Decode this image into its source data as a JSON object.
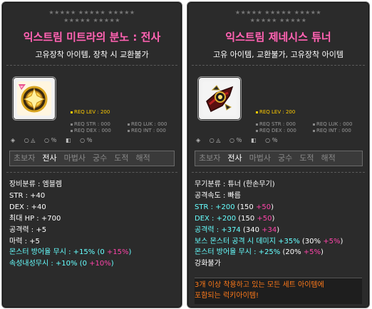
{
  "left": {
    "stars_row1": "★★★★★ ★★★★★ ★★★★★",
    "stars_row2": "★★★★★ ★★★★★",
    "title": "익스트림 미트라의 분노 : 전사",
    "desc": "고유장착 아이템, 장착 시 교환불가",
    "req_lev": "REQ LEV : 200",
    "req_str": "REQ STR : 000",
    "req_dex": "REQ DEX : 000",
    "req_luk": "REQ LUK : 000",
    "req_int": "REQ INT : 000",
    "jobs": [
      "초보자",
      "전사",
      "마법사",
      "궁수",
      "도적",
      "해적"
    ],
    "active_job_index": 1,
    "lines": {
      "category": "장비분류 : 엠블렘",
      "str": "STR : +40",
      "dex": "DEX : +40",
      "hp": "최대 HP : +700",
      "att": "공격력 : +5",
      "matt": "마력 : +5",
      "ignore_def_label": "몬스터 방어율 무시 : +15% (0 ",
      "ignore_def_bonus": "+15%",
      "ignore_def_close": ")",
      "ele_label": "속성내성무시 : +10% (0 ",
      "ele_bonus": "+10%",
      "ele_close": ")"
    }
  },
  "right": {
    "stars_row1": "★★★★★ ★★★★★ ★★★★★",
    "stars_row2": "★★★★★ ★★★★★",
    "title": "익스트림 제네시스 튜너",
    "desc": "고유 아이템, 교환불가, 고유장착 아이템",
    "req_lev": "REQ LEV : 200",
    "req_str": "REQ STR : 000",
    "req_dex": "REQ DEX : 000",
    "req_luk": "REQ LUK : 000",
    "req_int": "REQ INT : 000",
    "jobs": [
      "초보자",
      "전사",
      "마법사",
      "궁수",
      "도적",
      "해적"
    ],
    "active_job_index": 1,
    "lines": {
      "category": "무기분류 : 튜너 (한손무기)",
      "speed": "공격속도 : 빠름",
      "str_a": "STR : +200",
      "str_b": " (150 ",
      "str_c": "+50",
      "str_d": ")",
      "dex_a": "DEX : +200",
      "dex_b": " (150 ",
      "dex_c": "+50",
      "dex_d": ")",
      "att_a": "공격력 : +374",
      "att_b": " (340 ",
      "att_c": "+34",
      "att_d": ")",
      "boss_a": "보스 몬스터 공격 시 데미지 +35%",
      "boss_b": " (30% ",
      "boss_c": "+5%",
      "boss_d": ")",
      "ign_a": "몬스터 방어율 무시 : +25%",
      "ign_b": " (20% ",
      "ign_c": "+5%",
      "ign_d": ")",
      "upgrade": "강화불가"
    },
    "set_line1": "3개 이상 착용하고 있는 모든 세트 아이템에",
    "set_line2": "포함되는 럭키아이템!"
  },
  "colors": {
    "title": "#ff66b4",
    "cyan": "#66ffff",
    "pink": "#ff44aa",
    "req": "#ffcc00",
    "set": "#ff7a1a"
  },
  "icons": {
    "item_left": "golden-emblem",
    "item_right": "dark-tuner-blade"
  }
}
